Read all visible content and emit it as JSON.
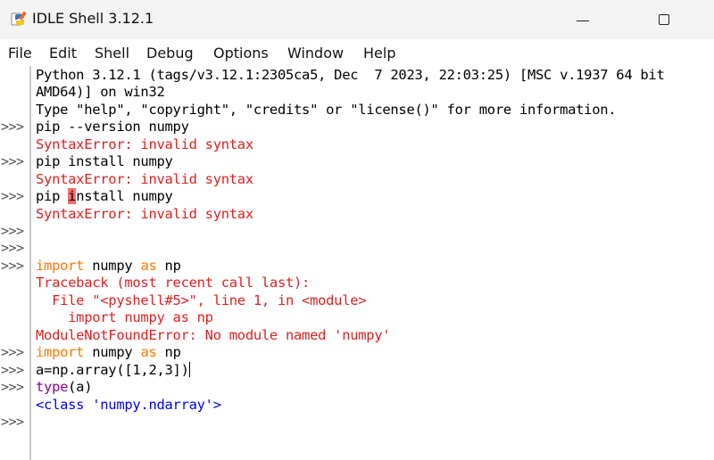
{
  "window": {
    "title": "IDLE Shell 3.12.1"
  },
  "menubar": {
    "items": [
      "File",
      "Edit",
      "Shell",
      "Debug",
      "Options",
      "Window",
      "Help"
    ]
  },
  "shell": {
    "prompt": ">>>",
    "banner": [
      "Python 3.12.1 (tags/v3.12.1:2305ca5, Dec  7 2023, 22:03:25) [MSC v.1937 64 bit",
      "AMD64)] on win32",
      "Type \"help\", \"copyright\", \"credits\" or \"license()\" for more information."
    ],
    "cmd1": "pip --version numpy",
    "err1": "SyntaxError: invalid syntax",
    "cmd2": "pip install numpy",
    "err2": "SyntaxError: invalid syntax",
    "cmd3_pre": "pip ",
    "cmd3_hl": "i",
    "cmd3_post": "nstall numpy",
    "err3": "SyntaxError: invalid syntax",
    "import_kw": "import",
    "numpy_mid": " numpy ",
    "as_kw": "as",
    "np_end": " np",
    "traceback": [
      "Traceback (most recent call last):",
      "  File \"<pyshell#5>\", line 1, in <module>",
      "    import numpy as np",
      "ModuleNotFoundError: No module named 'numpy'"
    ],
    "cmd_array": "a=np.array([1,2,3])",
    "type_fn": "type",
    "type_args": "(a)",
    "output_class": "<class 'numpy.ndarray'>"
  }
}
